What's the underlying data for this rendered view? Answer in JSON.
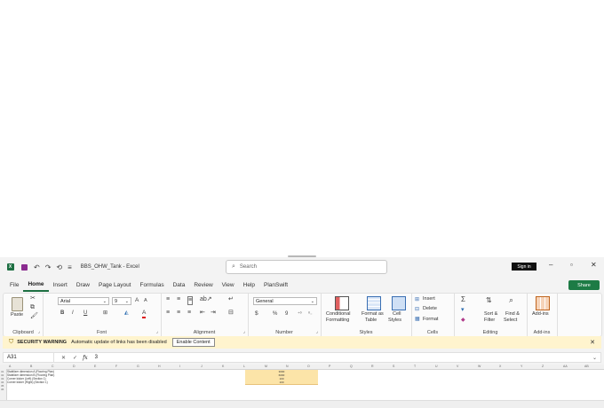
{
  "titlebar": {
    "doc_title": "BBS_OHW_Tank - Excel",
    "search_placeholder": "Search",
    "sign_in": "Sign in"
  },
  "tabs": [
    {
      "label": "File"
    },
    {
      "label": "Home"
    },
    {
      "label": "Insert"
    },
    {
      "label": "Draw"
    },
    {
      "label": "Page Layout"
    },
    {
      "label": "Formulas"
    },
    {
      "label": "Data"
    },
    {
      "label": "Review"
    },
    {
      "label": "View"
    },
    {
      "label": "Help"
    },
    {
      "label": "PlanSwift"
    }
  ],
  "share_label": "Share",
  "ribbon": {
    "clipboard": {
      "paste": "Paste",
      "group": "Clipboard"
    },
    "font": {
      "name": "Arial",
      "size": "9",
      "bold": "B",
      "italic": "I",
      "underline": "U",
      "grow": "A",
      "shrink": "A",
      "color_letter": "A",
      "group": "Font"
    },
    "alignment": {
      "group": "Alignment"
    },
    "number": {
      "format": "General",
      "currency": "$",
      "percent": "%",
      "comma": "9",
      "group": "Number"
    },
    "styles": {
      "conditional_1": "Conditional",
      "conditional_2": "Formatting",
      "table_1": "Format as",
      "table_2": "Table",
      "cell_1": "Cell",
      "cell_2": "Styles",
      "group": "Styles"
    },
    "cells": {
      "insert": "Insert",
      "delete": "Delete",
      "format": "Format",
      "group": "Cells"
    },
    "editing": {
      "sort_1": "Sort &",
      "sort_2": "Filter",
      "find_1": "Find &",
      "find_2": "Select",
      "group": "Editing"
    },
    "addins": {
      "label": "Add-ins",
      "group": "Add-ins"
    }
  },
  "security": {
    "title": "SECURITY WARNING",
    "message": "Automatic update of links has been disabled",
    "button": "Enable Content"
  },
  "formula_bar": {
    "name_box": "A31",
    "fx": "fx",
    "value": "3"
  },
  "columns": [
    "A",
    "B",
    "C",
    "D",
    "E",
    "F",
    "G",
    "H",
    "I",
    "J",
    "K",
    "L",
    "M",
    "N",
    "O",
    "P",
    "Q",
    "R",
    "S",
    "T",
    "U",
    "V",
    "W",
    "X",
    "Y",
    "Z",
    "AA",
    "AB"
  ],
  "rows": [
    "31",
    "32",
    "33",
    "34",
    "35",
    "36"
  ],
  "row_texts": [
    "Stabilizer dimension A (Flooring Plan)",
    "Stabilizer dimension B (Flooring Plan)",
    "Corner kicker (Left) (Section 1)",
    "Corner kicker (Right) (Section 1)"
  ],
  "highlighted_values": [
    "3000",
    "6000",
    "100",
    "100"
  ]
}
